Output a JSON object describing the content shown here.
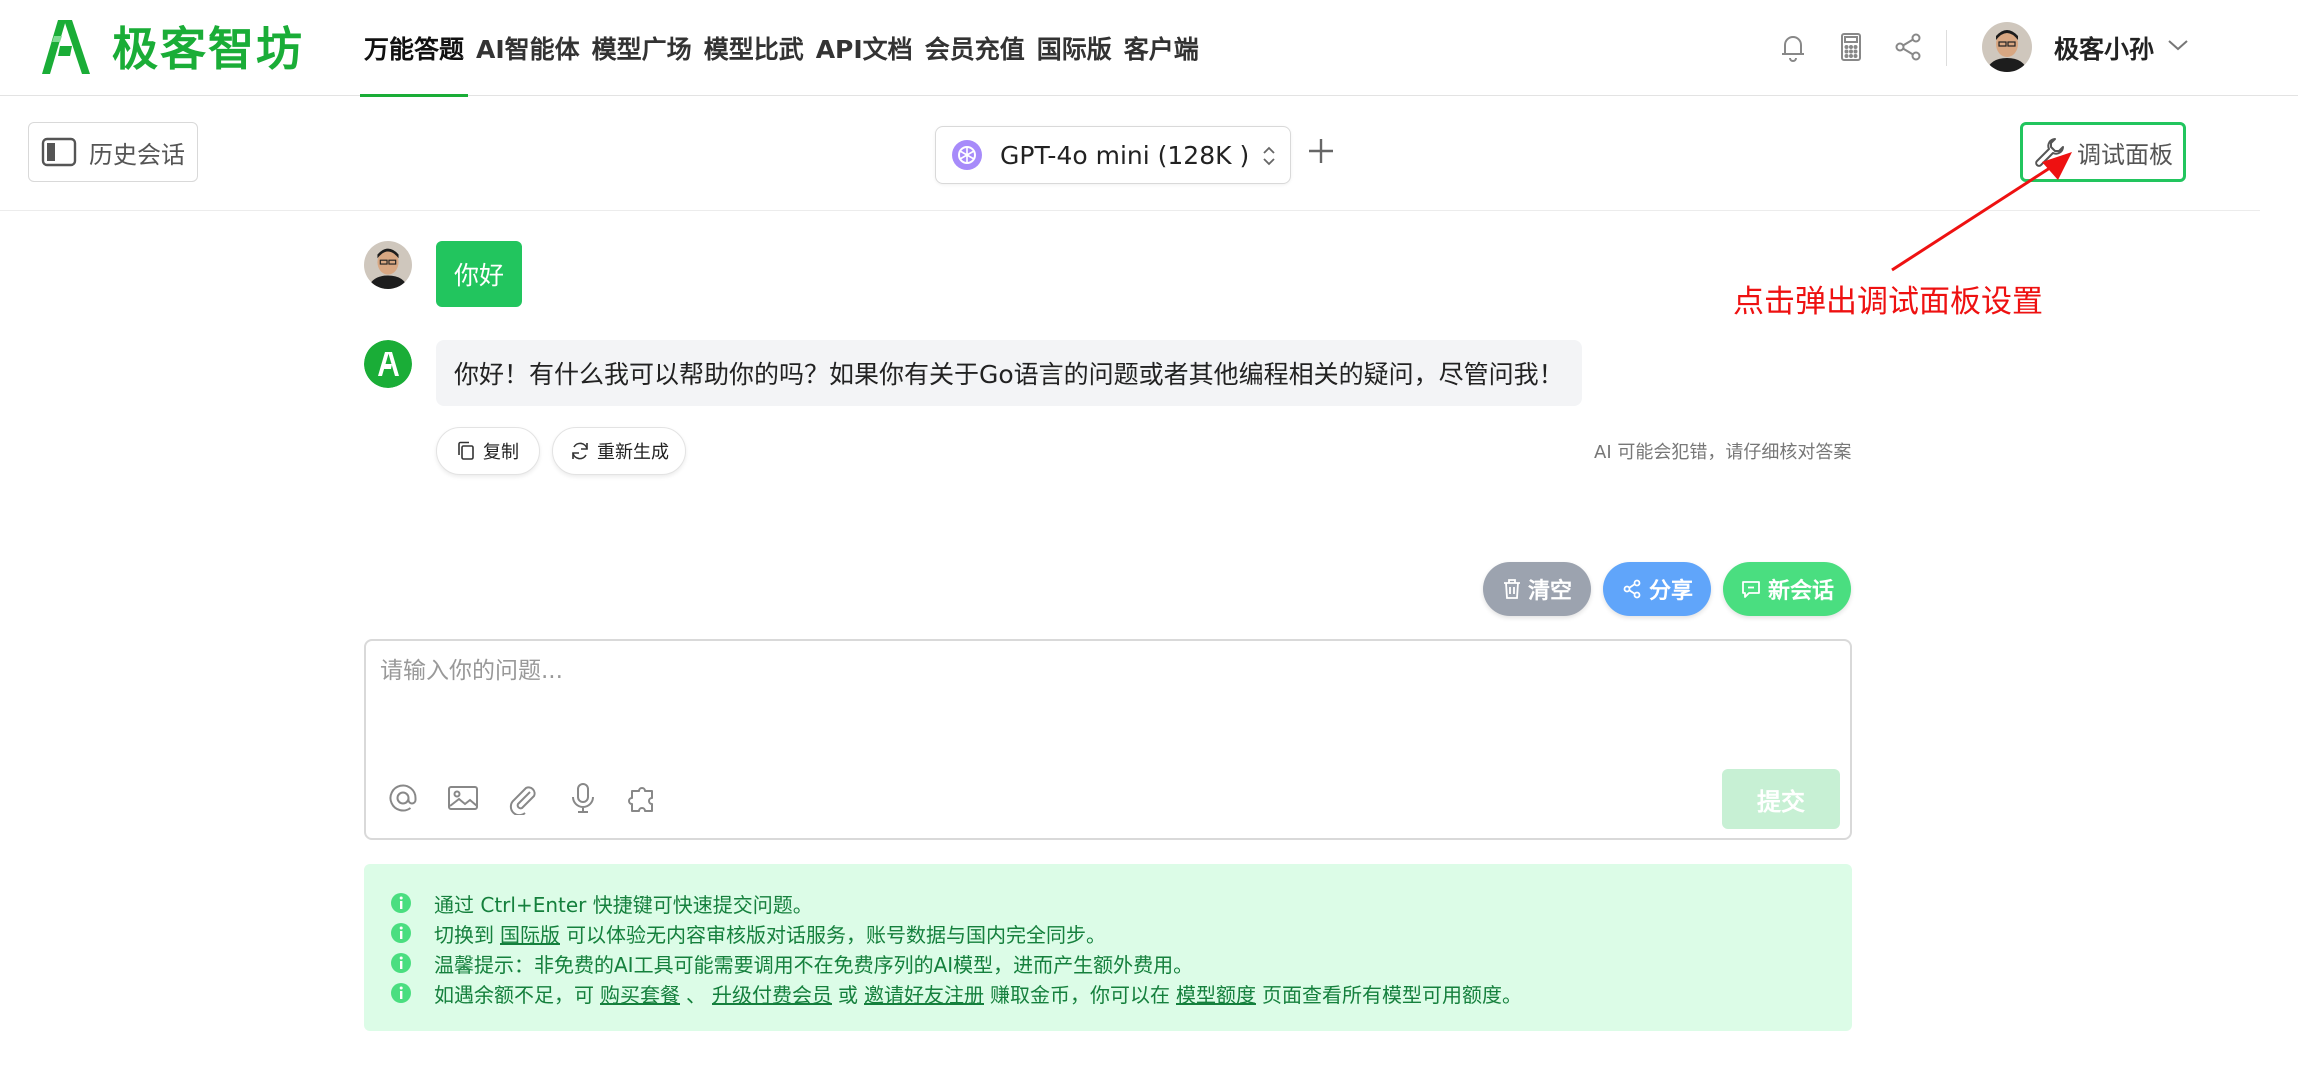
{
  "brand": {
    "name": "极客智坊",
    "color": "#1aad37"
  },
  "nav": {
    "items": [
      {
        "label": "万能答题",
        "active": true
      },
      {
        "label": "AI智能体",
        "active": false
      },
      {
        "label": "模型广场",
        "active": false
      },
      {
        "label": "模型比武",
        "active": false
      },
      {
        "label": "API文档",
        "active": false
      },
      {
        "label": "会员充值",
        "active": false
      },
      {
        "label": "国际版",
        "active": false
      },
      {
        "label": "客户端",
        "active": false
      }
    ]
  },
  "header_icons": [
    "bell-icon",
    "calculator-icon",
    "share-icon",
    "chevron-down-icon"
  ],
  "user": {
    "name": "极客小孙"
  },
  "toolbar": {
    "history_label": "历史会话",
    "model_label": "GPT-4o mini (128K )",
    "debug_label": "调试面板"
  },
  "annotation": {
    "text": "点击弹出调试面板设置",
    "color": "#ee1111"
  },
  "chat": {
    "user_message": "你好",
    "bot_message": "你好！有什么我可以帮助你的吗？如果你有关于Go语言的问题或者其他编程相关的疑问，尽管问我！",
    "copy_label": "复制",
    "regenerate_label": "重新生成",
    "disclaimer": "AI 可能会犯错，请仔细核对答案"
  },
  "actions": {
    "clear_label": "清空",
    "share_label": "分享",
    "new_chat_label": "新会话"
  },
  "input": {
    "placeholder": "请输入你的问题...",
    "value": "",
    "submit_label": "提交",
    "tools": [
      "at-icon",
      "image-icon",
      "paperclip-icon",
      "microphone-icon",
      "plugin-icon"
    ]
  },
  "tips": {
    "t1": "通过 Ctrl+Enter 快捷键可快速提交问题。",
    "t2_pre": "切换到",
    "t2_link": "国际版",
    "t2_post": "可以体验无内容审核版对话服务，账号数据与国内完全同步。",
    "t3": "温馨提示：非免费的AI工具可能需要调用不在免费序列的AI模型，进而产生额外费用。",
    "t4_pre": "如遇余额不足，可",
    "t4_link1": "购买套餐",
    "t4_sep1": "、",
    "t4_link2": "升级付费会员",
    "t4_mid": "或",
    "t4_link3": "邀请好友注册",
    "t4_mid2": "赚取金币，你可以在",
    "t4_link4": "模型额度",
    "t4_post": "页面查看所有模型可用额度。"
  },
  "colors": {
    "primary_green": "#22c55e",
    "tip_bg": "#dcfce7",
    "tip_text": "#15803d",
    "clear_pill": "#9ca3af",
    "share_pill": "#60a5fa",
    "new_pill": "#4ade80"
  }
}
